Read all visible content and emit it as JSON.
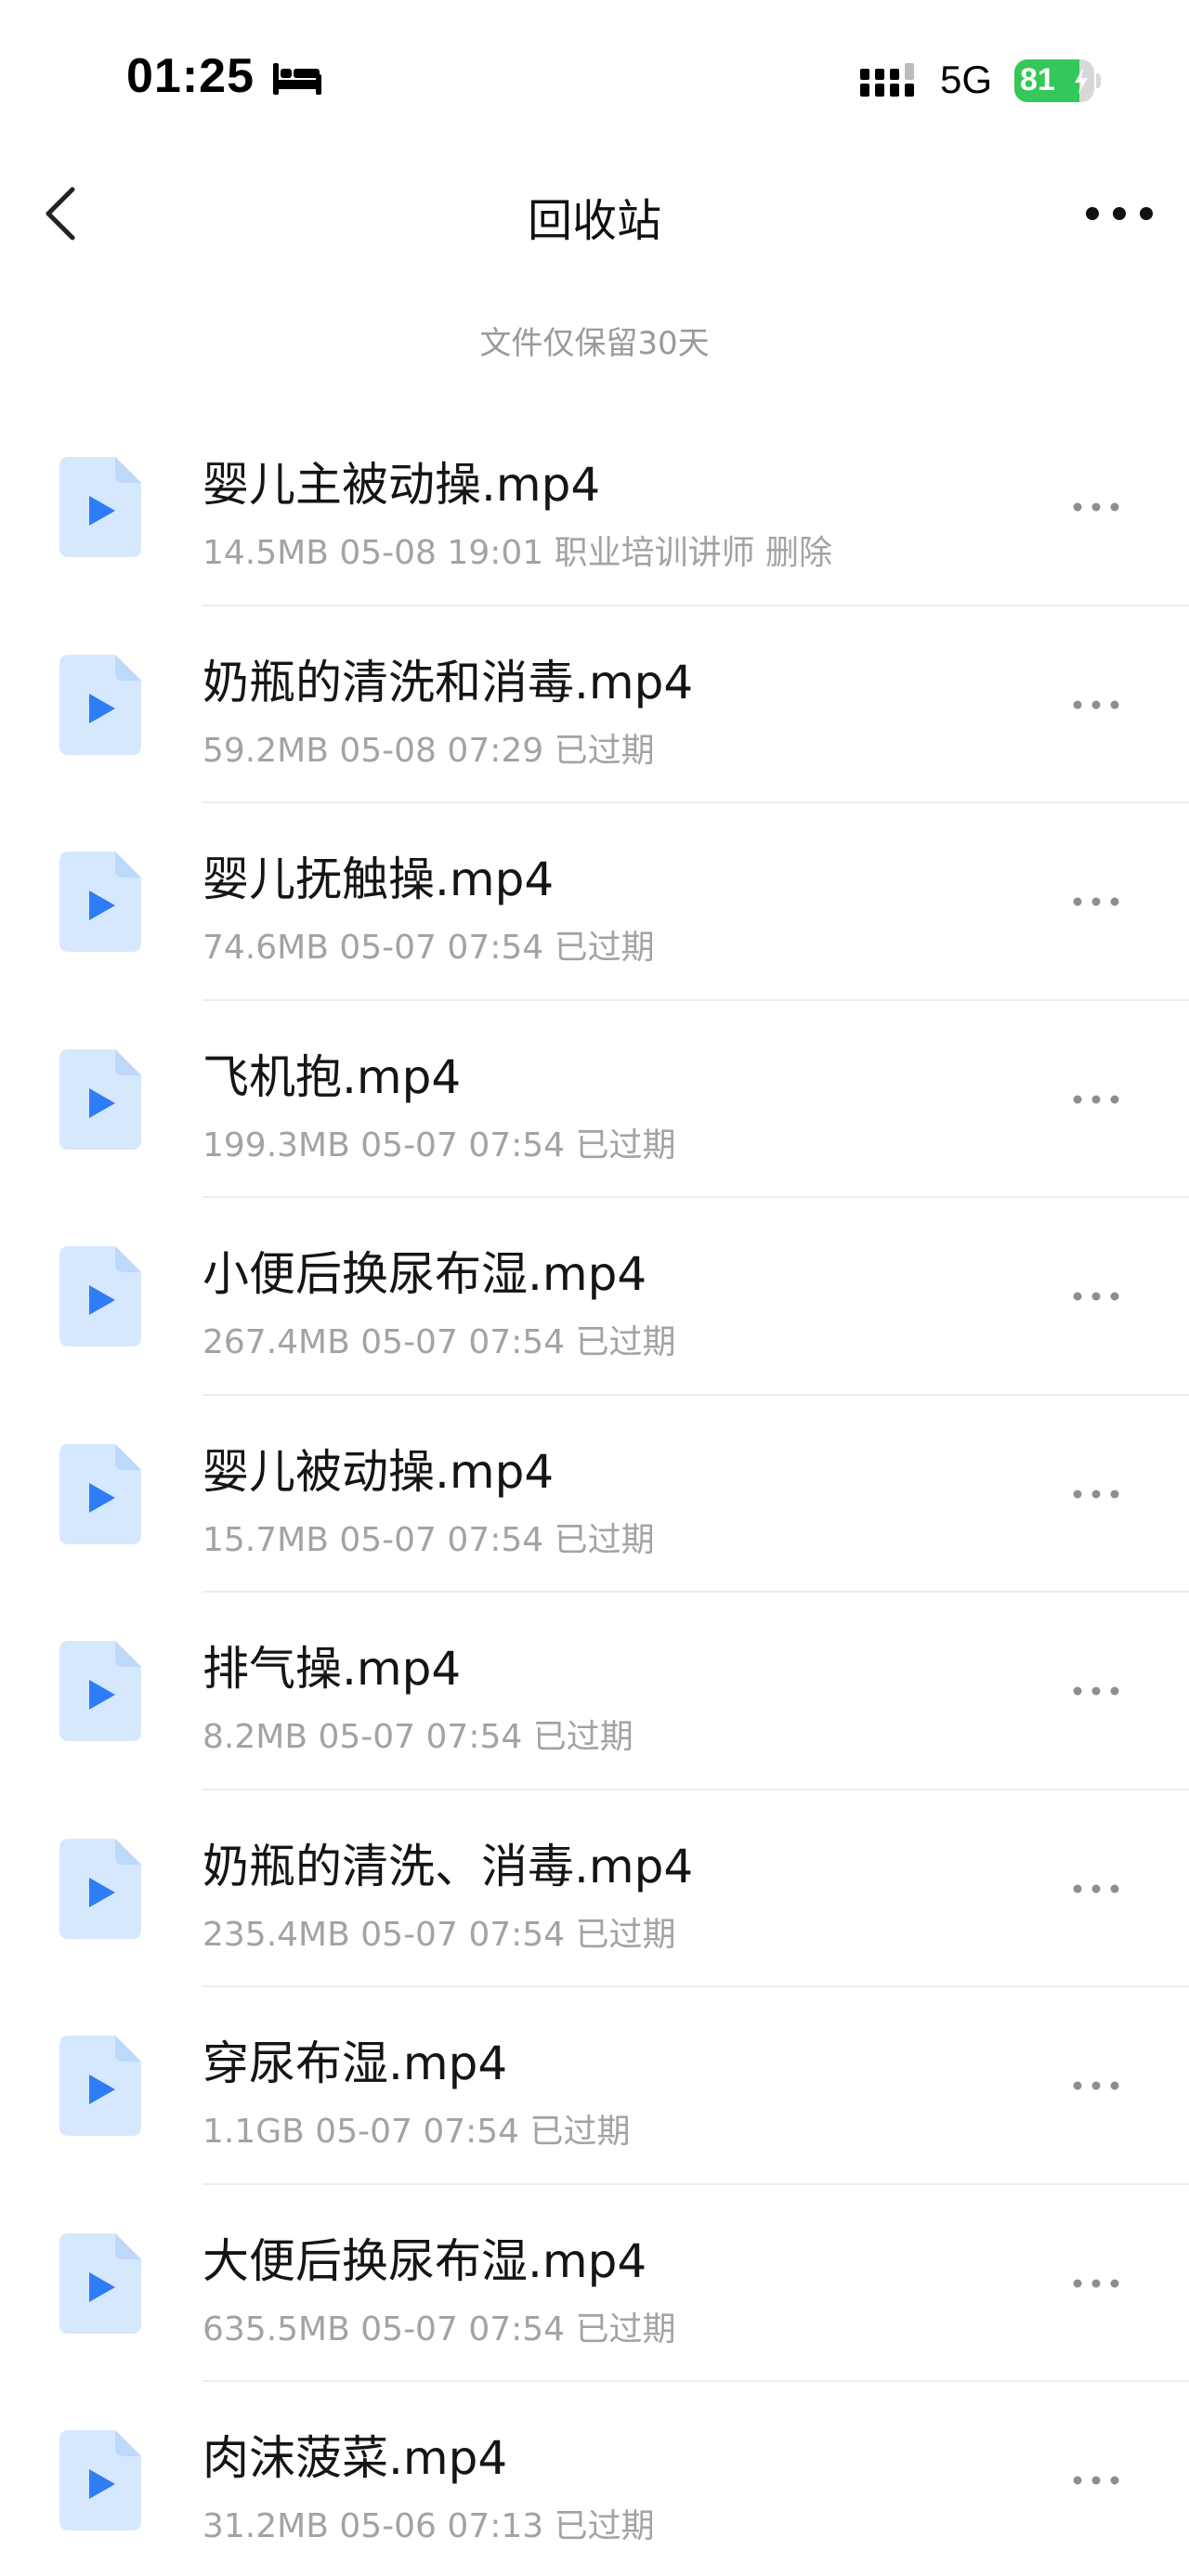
{
  "status_bar": {
    "time": "01:25",
    "network": "5G",
    "battery_level": "81",
    "battery_fraction": 0.81,
    "battery_color": "#34c759"
  },
  "nav": {
    "title": "回收站",
    "back_icon": "chevron-left-icon",
    "more_icon": "more-horizontal-icon"
  },
  "retention_note": "文件仅保留30天",
  "files": [
    {
      "name": "婴儿主被动操.mp4",
      "meta": "14.5MB 05-08 19:01 职业培训讲师 删除"
    },
    {
      "name": "奶瓶的清洗和消毒.mp4",
      "meta": "59.2MB 05-08 07:29 已过期"
    },
    {
      "name": "婴儿抚触操.mp4",
      "meta": "74.6MB 05-07 07:54 已过期"
    },
    {
      "name": "飞机抱.mp4",
      "meta": "199.3MB 05-07 07:54 已过期"
    },
    {
      "name": "小便后换尿布湿.mp4",
      "meta": "267.4MB 05-07 07:54 已过期"
    },
    {
      "name": "婴儿被动操.mp4",
      "meta": "15.7MB 05-07 07:54 已过期"
    },
    {
      "name": "排气操.mp4",
      "meta": "8.2MB 05-07 07:54 已过期"
    },
    {
      "name": "奶瓶的清洗、消毒.mp4",
      "meta": "235.4MB 05-07 07:54 已过期"
    },
    {
      "name": "穿尿布湿.mp4",
      "meta": "1.1GB 05-07 07:54 已过期"
    },
    {
      "name": "大便后换尿布湿.mp4",
      "meta": "635.5MB 05-07 07:54 已过期"
    },
    {
      "name": "肉沫菠菜.mp4",
      "meta": "31.2MB 05-06 07:13 已过期"
    }
  ],
  "colors": {
    "file_icon_bg": "#d6e8fd",
    "file_icon_play": "#2e7cf6",
    "secondary_text": "#a3a3a3"
  }
}
